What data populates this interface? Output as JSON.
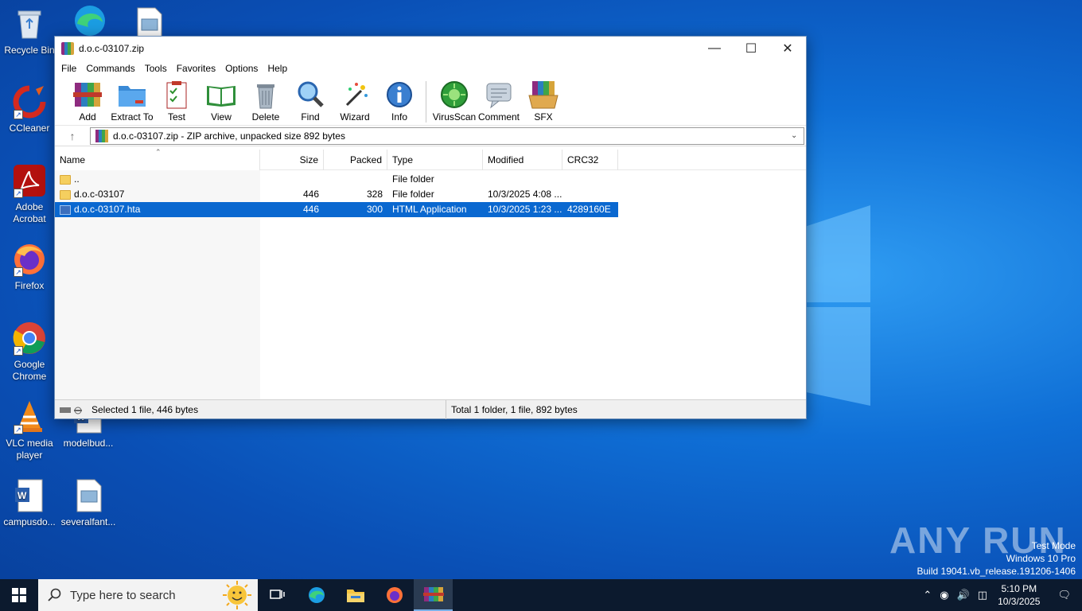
{
  "desktop": {
    "icons": [
      {
        "label": "Recycle Bin"
      },
      {
        "label": "CCleaner"
      },
      {
        "label": "Adobe Acrobat"
      },
      {
        "label": "Firefox"
      },
      {
        "label": "Google Chrome"
      },
      {
        "label": "VLC media player"
      },
      {
        "label": "modelbud..."
      },
      {
        "label": "campusdo..."
      },
      {
        "label": "severalfant..."
      }
    ]
  },
  "window": {
    "title": "d.o.c-03107.zip",
    "menu": [
      "File",
      "Commands",
      "Tools",
      "Favorites",
      "Options",
      "Help"
    ],
    "toolbar": [
      "Add",
      "Extract To",
      "Test",
      "View",
      "Delete",
      "Find",
      "Wizard",
      "Info",
      "VirusScan",
      "Comment",
      "SFX"
    ],
    "address": "d.o.c-03107.zip - ZIP archive, unpacked size 892 bytes",
    "columns": [
      "Name",
      "Size",
      "Packed",
      "Type",
      "Modified",
      "CRC32"
    ],
    "rows": [
      {
        "name": "..",
        "size": "",
        "packed": "",
        "type": "File folder",
        "modified": "",
        "crc": "",
        "icon": "folder-icon"
      },
      {
        "name": "d.o.c-03107",
        "size": "446",
        "packed": "328",
        "type": "File folder",
        "modified": "10/3/2025 4:08 ...",
        "crc": "",
        "icon": "folder-icon"
      },
      {
        "name": "d.o.c-03107.hta",
        "size": "446",
        "packed": "300",
        "type": "HTML Application",
        "modified": "10/3/2025 1:23 ...",
        "crc": "4289160E",
        "icon": "hta-file-icon"
      }
    ],
    "status_left": "Selected 1 file, 446 bytes",
    "status_right": "Total 1 folder, 1 file, 892 bytes"
  },
  "watermark": {
    "brand": "ANY RUN",
    "line1": "Test Mode",
    "line2": "Windows 10 Pro",
    "line3": "Build 19041.vb_release.191206-1406"
  },
  "taskbar": {
    "search_placeholder": "Type here to search",
    "time": "5:10 PM",
    "date": "10/3/2025"
  }
}
